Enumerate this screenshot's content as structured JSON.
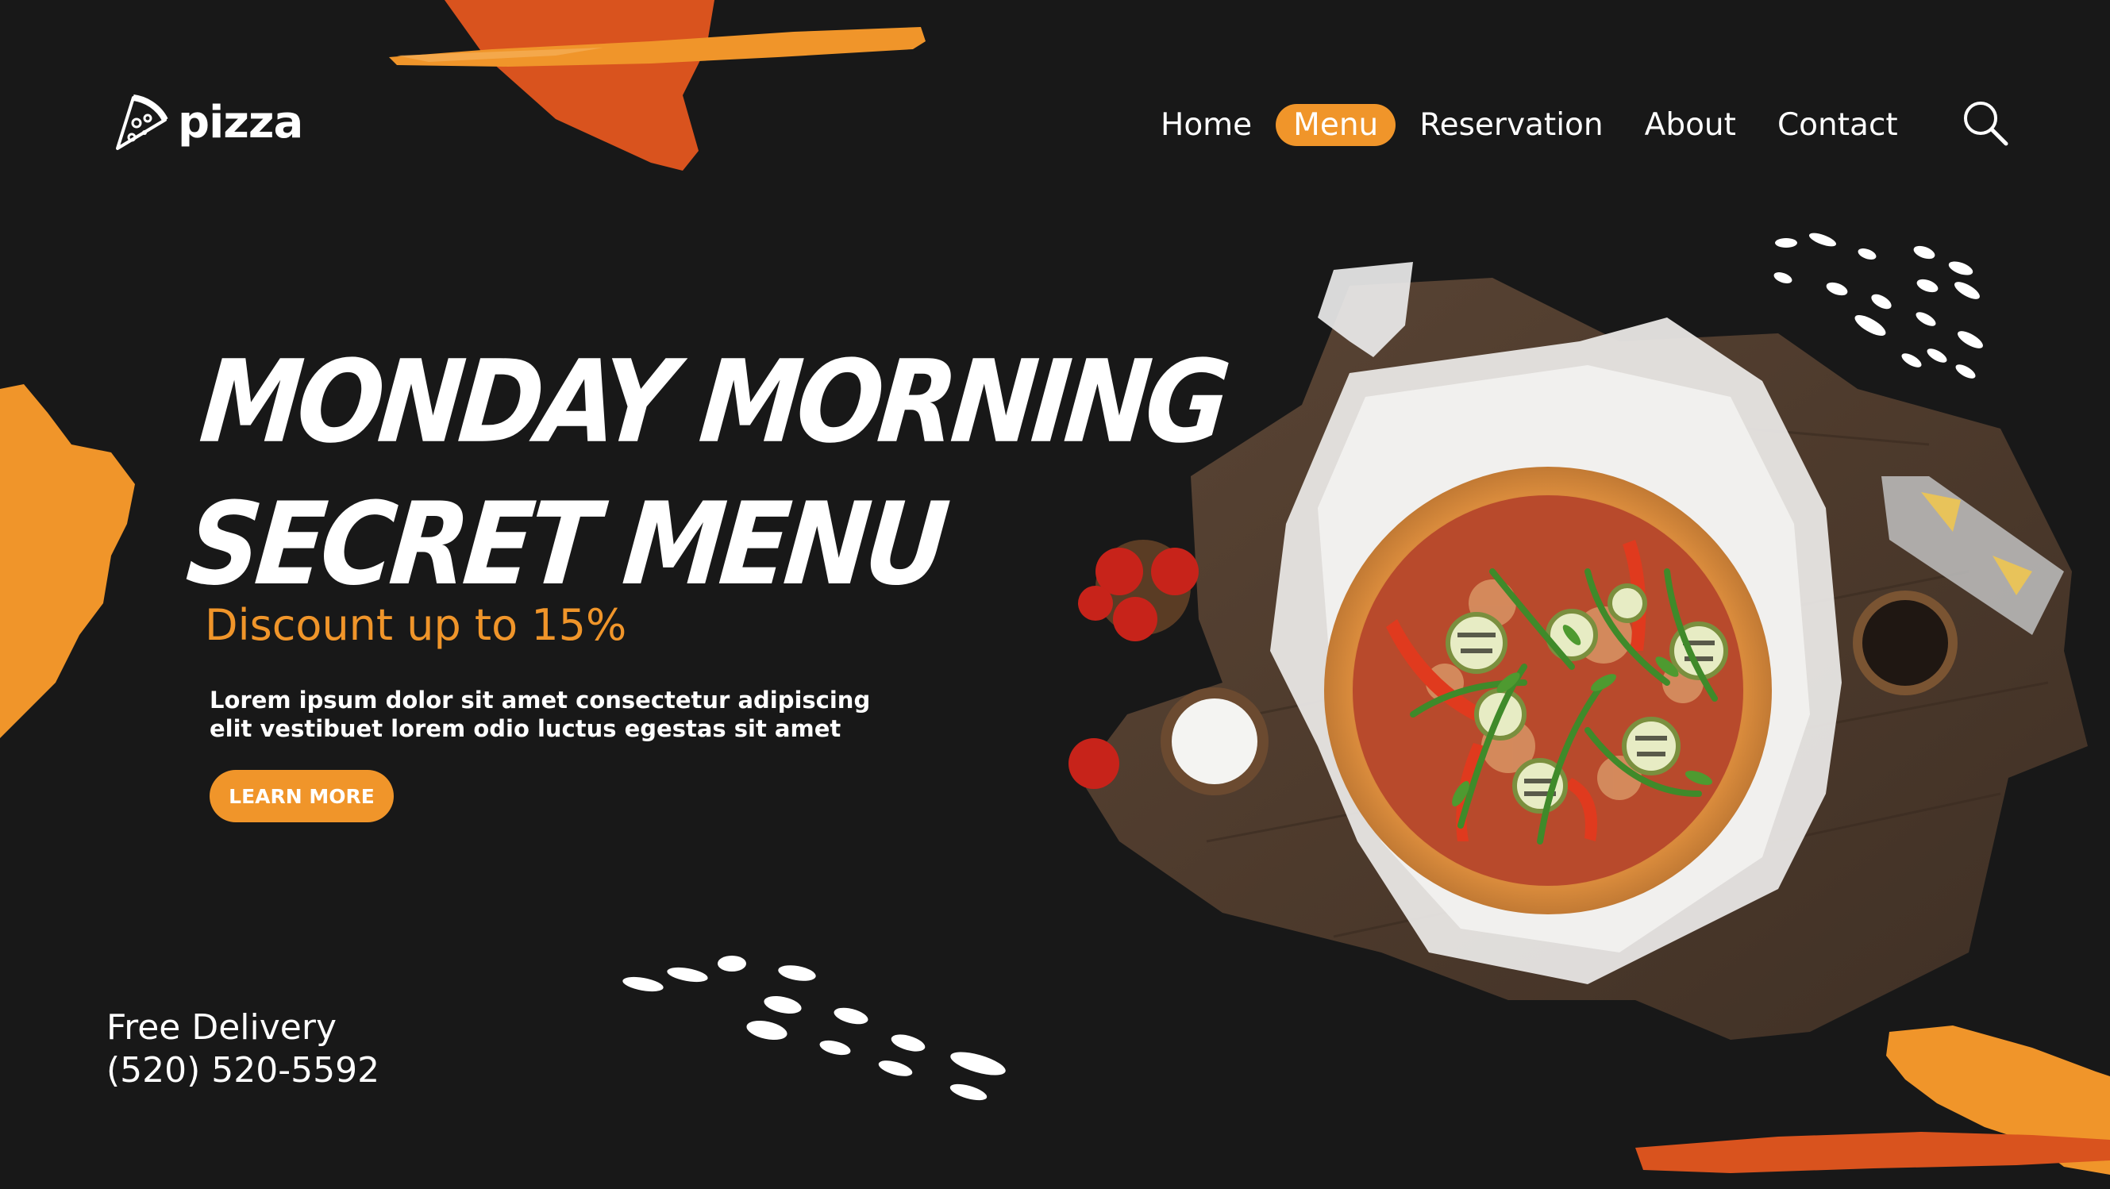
{
  "brand": {
    "name": "pizza",
    "logo_icon": "pizza-slice-icon"
  },
  "nav": {
    "items": [
      {
        "label": "Home",
        "active": false
      },
      {
        "label": "Menu",
        "active": true
      },
      {
        "label": "Reservation",
        "active": false
      },
      {
        "label": "About",
        "active": false
      },
      {
        "label": "Contact",
        "active": false
      }
    ],
    "search_icon": "search-icon"
  },
  "hero": {
    "headline_line1": "Monday Morning",
    "headline_line2": "Secret Menu",
    "discount": "Discount up to 15%",
    "body_line1": "Lorem ipsum dolor sit amet consectetur adipiscing",
    "body_line2": "elit vestibuet lorem odio luctus egestas sit amet",
    "cta_label": "LEARN MORE"
  },
  "footer": {
    "delivery_label": "Free Delivery",
    "phone": "(520) 520-5592"
  },
  "colors": {
    "background": "#181818",
    "accent_orange": "#f0952a",
    "accent_red": "#d9531e",
    "text": "#ffffff"
  }
}
